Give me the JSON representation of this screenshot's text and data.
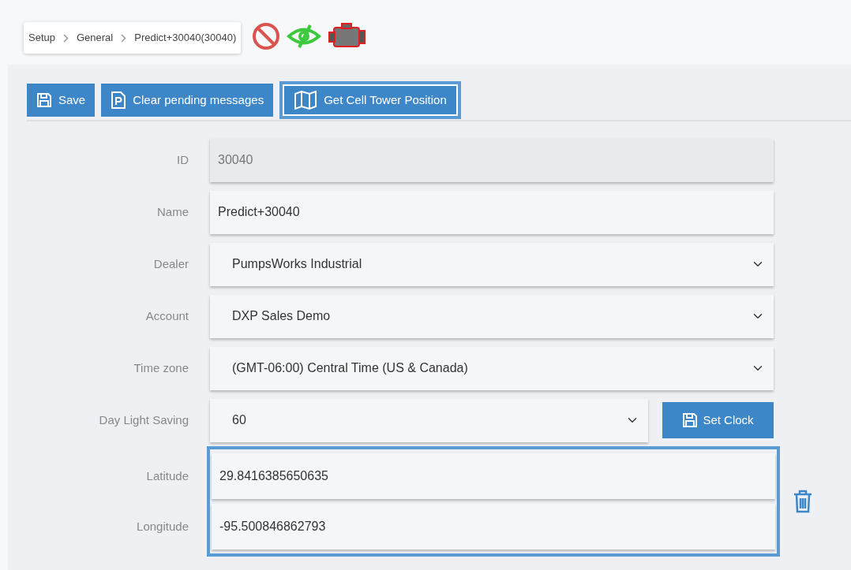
{
  "breadcrumb": [
    "Setup",
    "General",
    "Predict+30040(30040)"
  ],
  "status_icons": [
    {
      "kind": "blocked"
    },
    {
      "kind": "visibility"
    },
    {
      "kind": "motor"
    }
  ],
  "toolbar": [
    {
      "label": "Save",
      "kind": "save",
      "highlighted": false
    },
    {
      "label": "Clear pending messages",
      "kind": "document",
      "highlighted": false
    },
    {
      "label": "Get Cell Tower Position",
      "kind": "map",
      "highlighted": true
    }
  ],
  "fields": [
    {
      "label": "ID",
      "kind": "readonly",
      "value": "30040"
    },
    {
      "label": "Name",
      "kind": "text",
      "value": "Predict+30040"
    },
    {
      "label": "Dealer",
      "kind": "select",
      "value": "PumpsWorks Industrial"
    },
    {
      "label": "Account",
      "kind": "select",
      "value": "DXP Sales Demo"
    },
    {
      "label": "Time zone",
      "kind": "select",
      "value": "(GMT-06:00) Central Time (US & Canada)"
    },
    {
      "label": "Day Light Saving",
      "kind": "select",
      "value": "60",
      "button": "Set Clock"
    }
  ],
  "coordinates": {
    "highlighted": true,
    "fields": [
      {
        "label": "Latitude",
        "value": "29.8416385650635"
      },
      {
        "label": "Longitude",
        "value": "-95.500846862793"
      }
    ]
  }
}
